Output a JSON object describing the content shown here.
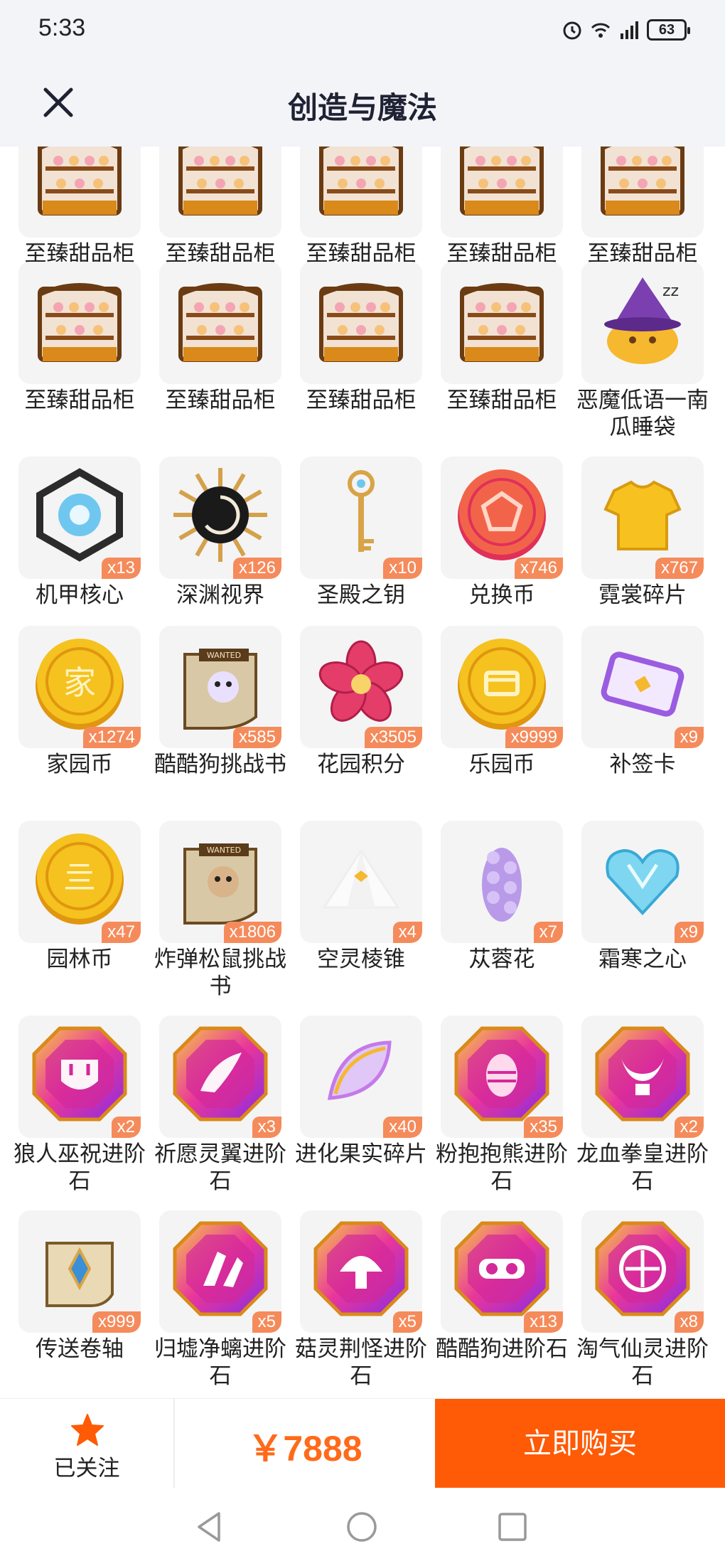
{
  "status_bar": {
    "time": "5:33",
    "battery": "63",
    "network": "4G"
  },
  "header": {
    "title": "创造与魔法"
  },
  "items": [
    {
      "name": "至臻甜品柜",
      "count": "",
      "icon": "dessert-cabinet"
    },
    {
      "name": "至臻甜品柜",
      "count": "",
      "icon": "dessert-cabinet"
    },
    {
      "name": "至臻甜品柜",
      "count": "",
      "icon": "dessert-cabinet"
    },
    {
      "name": "至臻甜品柜",
      "count": "",
      "icon": "dessert-cabinet"
    },
    {
      "name": "至臻甜品柜",
      "count": "",
      "icon": "dessert-cabinet"
    },
    {
      "name": "至臻甜品柜",
      "count": "",
      "icon": "dessert-cabinet"
    },
    {
      "name": "至臻甜品柜",
      "count": "",
      "icon": "dessert-cabinet"
    },
    {
      "name": "至臻甜品柜",
      "count": "",
      "icon": "dessert-cabinet"
    },
    {
      "name": "至臻甜品柜",
      "count": "",
      "icon": "dessert-cabinet"
    },
    {
      "name": "恶魔低语一南瓜睡袋",
      "count": "",
      "icon": "pumpkin-sleeping-bag"
    },
    {
      "name": "机甲核心",
      "count": "x13",
      "icon": "mech-core"
    },
    {
      "name": "深渊视界",
      "count": "x126",
      "icon": "abyss-vision"
    },
    {
      "name": "圣殿之钥",
      "count": "x10",
      "icon": "temple-key"
    },
    {
      "name": "兑换币",
      "count": "x746",
      "icon": "exchange-coin"
    },
    {
      "name": "霓裳碎片",
      "count": "x767",
      "icon": "clothing-shard"
    },
    {
      "name": "家园币",
      "count": "x1274",
      "icon": "home-coin"
    },
    {
      "name": "酷酷狗挑战书",
      "count": "x585",
      "icon": "wanted-scroll-dog"
    },
    {
      "name": "花园积分",
      "count": "x3505",
      "icon": "garden-flower"
    },
    {
      "name": "乐园币",
      "count": "x9999",
      "icon": "paradise-coin"
    },
    {
      "name": "补签卡",
      "count": "x9",
      "icon": "resign-card"
    },
    {
      "name": "园林币",
      "count": "x47",
      "icon": "garden-coin"
    },
    {
      "name": "炸弹松鼠挑战书",
      "count": "x1806",
      "icon": "wanted-scroll-squirrel"
    },
    {
      "name": "空灵棱锥",
      "count": "x4",
      "icon": "ethereal-pyramid"
    },
    {
      "name": "苁蓉花",
      "count": "x7",
      "icon": "cistanche-flower"
    },
    {
      "name": "霜寒之心",
      "count": "x9",
      "icon": "frost-heart"
    },
    {
      "name": "狼人巫祝进阶石",
      "count": "x2",
      "icon": "gem-mask"
    },
    {
      "name": "祈愿灵翼进阶石",
      "count": "x3",
      "icon": "gem-wing"
    },
    {
      "name": "进化果实碎片",
      "count": "x40",
      "icon": "fruit-slice"
    },
    {
      "name": "粉抱抱熊进阶石",
      "count": "x35",
      "icon": "gem-egg"
    },
    {
      "name": "龙血拳皇进阶石",
      "count": "x2",
      "icon": "gem-horns"
    },
    {
      "name": "传送卷轴",
      "count": "x999",
      "icon": "teleport-scroll"
    },
    {
      "name": "归墟净螭进阶石",
      "count": "x5",
      "icon": "gem-claw"
    },
    {
      "name": "菇灵荆怪进阶石",
      "count": "x5",
      "icon": "gem-mushroom"
    },
    {
      "name": "酷酷狗进阶石",
      "count": "x13",
      "icon": "gem-goggles"
    },
    {
      "name": "淘气仙灵进阶石",
      "count": "x8",
      "icon": "gem-fairy"
    }
  ],
  "bottom_bar": {
    "follow_label": "已关注",
    "price": "￥7888",
    "buy_label": "立即购买"
  },
  "colors": {
    "accent": "#ff5a05",
    "price": "#ff6a1a",
    "badge": "#f58b5b",
    "header_bg": "#f2f4f8"
  }
}
